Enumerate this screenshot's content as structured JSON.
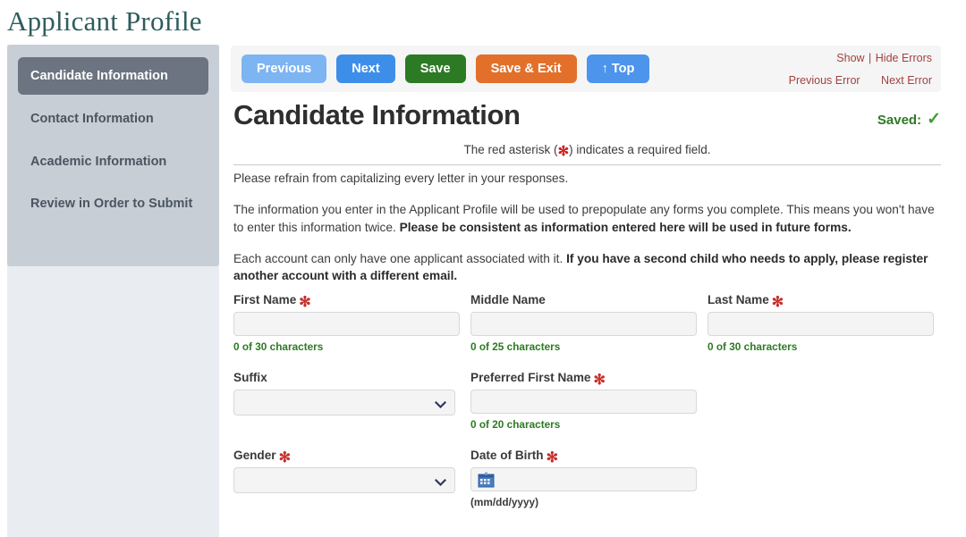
{
  "page": {
    "title": "Applicant Profile"
  },
  "sidebar": {
    "items": [
      {
        "label": "Candidate Information",
        "active": true
      },
      {
        "label": "Contact Information",
        "active": false
      },
      {
        "label": "Academic Information",
        "active": false
      },
      {
        "label": "Review in Order to Submit",
        "active": false
      }
    ]
  },
  "toolbar": {
    "previous_label": "Previous",
    "next_label": "Next",
    "save_label": "Save",
    "save_exit_label": "Save & Exit",
    "top_label": "↑ Top",
    "errors": {
      "show_label": "Show",
      "separator": "|",
      "hide_label": "Hide Errors",
      "previous_error_label": "Previous Error",
      "next_error_label": "Next Error"
    }
  },
  "header": {
    "section_title": "Candidate Information",
    "saved_label": "Saved:",
    "saved_check": "✓",
    "required_note_before": "The red asterisk (",
    "required_note_asterisk": "✻",
    "required_note_after": ") indicates a required field."
  },
  "intro": {
    "p1": "Please refrain from capitalizing every letter in your responses.",
    "p2_plain": "The information you enter in the Applicant Profile will be used to prepopulate any forms you complete. This means you won't have to enter this information twice. ",
    "p2_bold": "Please be consistent as information entered here will be used in future forms.",
    "p3_plain": "Each account can only have one applicant associated with it. ",
    "p3_bold": "If you have a second child who needs to apply, please register another account with a different email."
  },
  "form": {
    "first_name": {
      "label": "First Name",
      "required": true,
      "value": "",
      "placeholder": "",
      "counter": "0 of 30 characters"
    },
    "middle_name": {
      "label": "Middle Name",
      "required": false,
      "value": "",
      "placeholder": "",
      "counter": "0 of 25 characters"
    },
    "last_name": {
      "label": "Last Name",
      "required": true,
      "value": "",
      "placeholder": "",
      "counter": "0 of 30 characters"
    },
    "suffix": {
      "label": "Suffix",
      "required": false,
      "value": "",
      "options": [
        ""
      ]
    },
    "preferred_first_name": {
      "label": "Preferred First Name",
      "required": true,
      "value": "",
      "placeholder": "",
      "counter": "0 of 20 characters"
    },
    "gender": {
      "label": "Gender",
      "required": true,
      "value": "",
      "options": [
        ""
      ]
    },
    "date_of_birth": {
      "label": "Date of Birth",
      "required": true,
      "value": "",
      "placeholder": "",
      "hint": "(mm/dd/yyyy)",
      "icon": "calendar-icon"
    }
  },
  "colors": {
    "title_teal": "#2f5c5c",
    "sidebar_bg": "#c7ced6",
    "sidebar_active": "#6b7480",
    "rail_bg": "#e9edf1",
    "btn_previous": "#7db4f2",
    "btn_next": "#3d8ee8",
    "btn_save": "#2d7a24",
    "btn_save_exit": "#e2702b",
    "btn_top": "#4c94ec",
    "error_link": "#a1423f",
    "required_asterisk": "#c4302b",
    "counter_green": "#2d7a24",
    "toolbar_bg": "#f5f5f5"
  }
}
